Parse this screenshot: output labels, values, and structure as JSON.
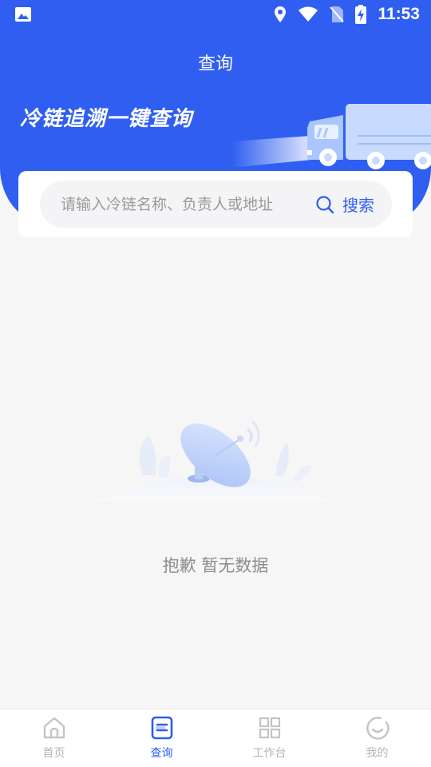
{
  "status_bar": {
    "time": "11:53"
  },
  "header": {
    "title": "查询",
    "slogan": "冷链追溯一键查询"
  },
  "search": {
    "placeholder": "请输入冷链名称、负责人或地址",
    "value": "",
    "button_label": "搜索"
  },
  "empty_state": {
    "message": "抱歉 暂无数据"
  },
  "bottom_nav": {
    "items": [
      {
        "label": "首页",
        "icon": "home-icon",
        "active": false
      },
      {
        "label": "查询",
        "icon": "query-icon",
        "active": true
      },
      {
        "label": "工作台",
        "icon": "workbench-icon",
        "active": false
      },
      {
        "label": "我的",
        "icon": "profile-icon",
        "active": false
      }
    ]
  },
  "colors": {
    "primary": "#2f5ef0",
    "background": "#f6f6f6",
    "inactive_nav": "#b5b5b5",
    "empty_text": "#8c8c8c"
  }
}
